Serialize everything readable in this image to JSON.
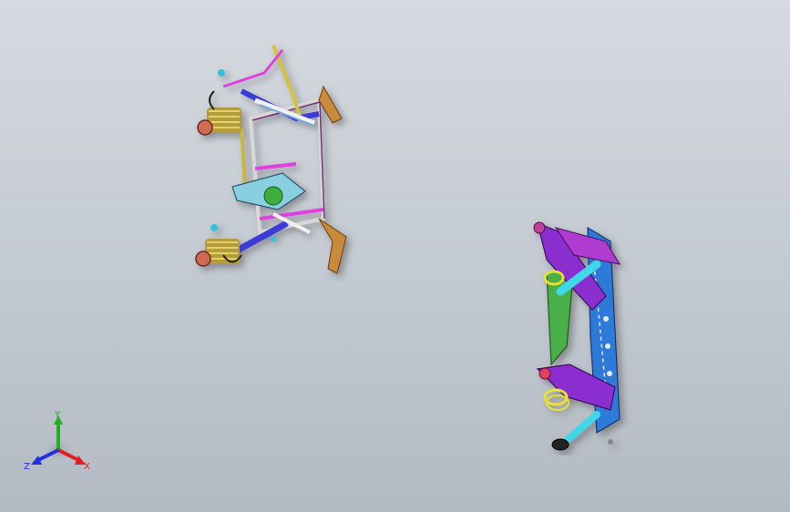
{
  "viewport": {
    "name": "3d-model-viewport"
  },
  "models": [
    {
      "id": "front-suspension-assembly"
    },
    {
      "id": "rear-suspension-assembly"
    }
  ],
  "triad": {
    "x_label": "X",
    "y_label": "Y",
    "z_label": "Z",
    "colors": {
      "x": "#e02020",
      "y": "#20b020",
      "z": "#2030e0"
    }
  }
}
